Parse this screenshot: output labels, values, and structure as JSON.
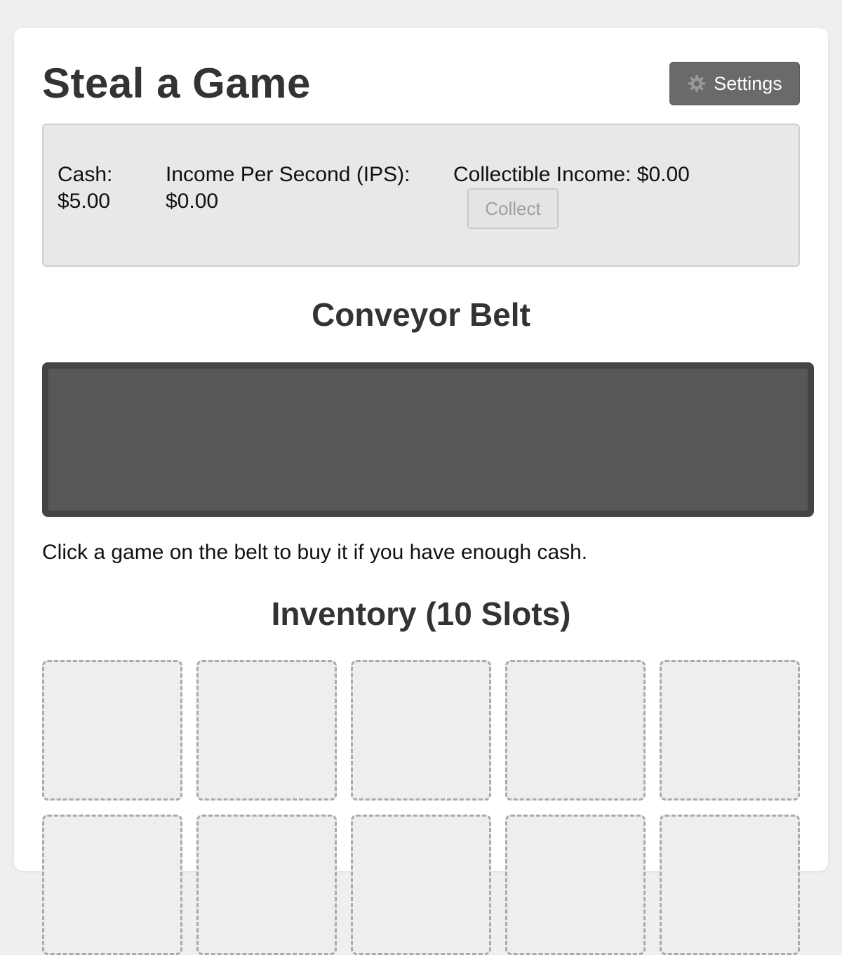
{
  "app": {
    "title": "Steal a Game"
  },
  "header": {
    "settings_label": "Settings",
    "settings_icon": "gear-icon"
  },
  "stats": {
    "cash_label": "Cash:",
    "cash_value": "$5.00",
    "ips_label": "Income Per Second (IPS):",
    "ips_value": "$0.00",
    "collectible_label": "Collectible Income:",
    "collectible_value": "$0.00",
    "collect_button": "Collect"
  },
  "belt": {
    "heading": "Conveyor Belt",
    "hint": "Click a game on the belt to buy it if you have enough cash."
  },
  "inventory": {
    "heading": "Inventory (10 Slots)",
    "slots": [
      {
        "item": ""
      },
      {
        "item": ""
      },
      {
        "item": ""
      },
      {
        "item": ""
      },
      {
        "item": ""
      },
      {
        "item": ""
      },
      {
        "item": ""
      },
      {
        "item": ""
      },
      {
        "item": ""
      },
      {
        "item": ""
      }
    ]
  },
  "colors": {
    "page_bg": "#efefef",
    "card_bg": "#ffffff",
    "settings_bg": "#6a6a6a",
    "stats_bg": "#e8e8e8",
    "belt_bg": "#575757",
    "belt_border": "#444444",
    "slot_bg": "#eeeeee",
    "slot_border": "#aaaaaa"
  }
}
